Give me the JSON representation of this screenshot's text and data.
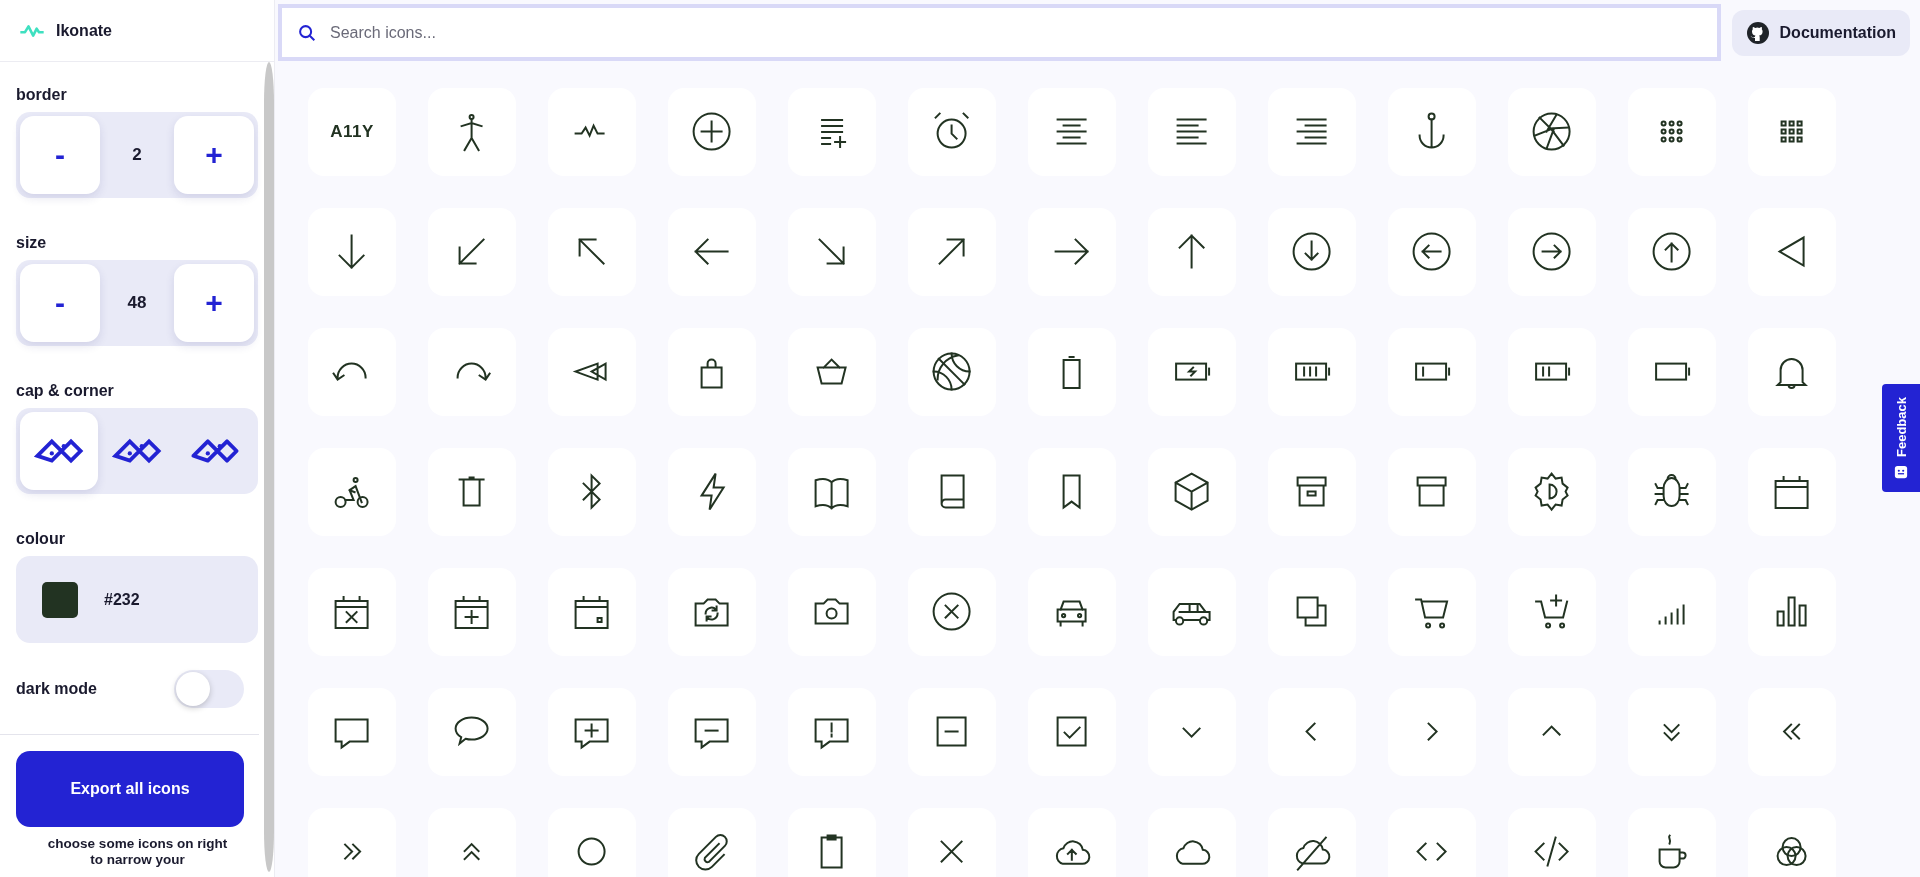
{
  "app": {
    "name": "Ikonate"
  },
  "search": {
    "placeholder": "Search icons..."
  },
  "documentation_button": {
    "label": "Documentation"
  },
  "sidebar": {
    "border": {
      "label": "border",
      "minus": "-",
      "value": "2",
      "plus": "+"
    },
    "size": {
      "label": "size",
      "minus": "-",
      "value": "48",
      "plus": "+"
    },
    "cap_corner": {
      "label": "cap & corner",
      "options": [
        {
          "kind": "square",
          "selected": true
        },
        {
          "kind": "round",
          "selected": false
        },
        {
          "kind": "rounded",
          "selected": false
        }
      ]
    },
    "colour": {
      "label": "colour",
      "value": "#232"
    },
    "dark_mode": {
      "label": "dark mode",
      "on": false
    },
    "export_button": {
      "label": "Export all icons"
    },
    "hint": "choose some icons on right to narrow your"
  },
  "icons": [
    {
      "kind": "text",
      "label": "A11Y"
    },
    {
      "kind": "person"
    },
    {
      "kind": "activity"
    },
    {
      "kind": "add-circle"
    },
    {
      "kind": "add-to-list"
    },
    {
      "kind": "alarm"
    },
    {
      "kind": "align-center"
    },
    {
      "kind": "align-left"
    },
    {
      "kind": "align-right"
    },
    {
      "kind": "anchor"
    },
    {
      "kind": "aperture"
    },
    {
      "kind": "dots-grid"
    },
    {
      "kind": "squares-grid"
    },
    {
      "kind": "arrow-down"
    },
    {
      "kind": "arrow-down-left"
    },
    {
      "kind": "arrow-up-left"
    },
    {
      "kind": "arrow-left"
    },
    {
      "kind": "arrow-down-right"
    },
    {
      "kind": "arrow-up-right"
    },
    {
      "kind": "arrow-right"
    },
    {
      "kind": "arrow-up"
    },
    {
      "kind": "circle-arrow-down"
    },
    {
      "kind": "circle-arrow-left"
    },
    {
      "kind": "circle-arrow-right"
    },
    {
      "kind": "circle-arrow-up"
    },
    {
      "kind": "triangle-left"
    },
    {
      "kind": "undo"
    },
    {
      "kind": "redo"
    },
    {
      "kind": "rewind"
    },
    {
      "kind": "bag"
    },
    {
      "kind": "basket"
    },
    {
      "kind": "ball"
    },
    {
      "kind": "battery-vertical"
    },
    {
      "kind": "battery-charging"
    },
    {
      "kind": "battery-full"
    },
    {
      "kind": "battery-low"
    },
    {
      "kind": "battery-medium"
    },
    {
      "kind": "battery-empty"
    },
    {
      "kind": "bell"
    },
    {
      "kind": "bike"
    },
    {
      "kind": "trash"
    },
    {
      "kind": "bluetooth"
    },
    {
      "kind": "bolt"
    },
    {
      "kind": "book-open"
    },
    {
      "kind": "book"
    },
    {
      "kind": "bookmark"
    },
    {
      "kind": "cube"
    },
    {
      "kind": "archive-box"
    },
    {
      "kind": "box"
    },
    {
      "kind": "brightness"
    },
    {
      "kind": "bug"
    },
    {
      "kind": "calendar"
    },
    {
      "kind": "calendar-remove"
    },
    {
      "kind": "calendar-add"
    },
    {
      "kind": "calendar-event"
    },
    {
      "kind": "camera-rotate"
    },
    {
      "kind": "camera"
    },
    {
      "kind": "close-circle"
    },
    {
      "kind": "car-front"
    },
    {
      "kind": "car-side"
    },
    {
      "kind": "copy"
    },
    {
      "kind": "cart"
    },
    {
      "kind": "cart-add"
    },
    {
      "kind": "signal"
    },
    {
      "kind": "bar-chart"
    },
    {
      "kind": "chat"
    },
    {
      "kind": "chat-bubble"
    },
    {
      "kind": "chat-add"
    },
    {
      "kind": "chat-remove"
    },
    {
      "kind": "chat-alert"
    },
    {
      "kind": "minus-square"
    },
    {
      "kind": "check-square"
    },
    {
      "kind": "chevron-down"
    },
    {
      "kind": "chevron-left"
    },
    {
      "kind": "chevron-right"
    },
    {
      "kind": "chevron-up"
    },
    {
      "kind": "chevrons-down"
    },
    {
      "kind": "chevrons-left"
    },
    {
      "kind": "chevrons-right"
    },
    {
      "kind": "chevrons-up"
    },
    {
      "kind": "circle"
    },
    {
      "kind": "paperclip"
    },
    {
      "kind": "clipboard"
    },
    {
      "kind": "close"
    },
    {
      "kind": "cloud-upload"
    },
    {
      "kind": "cloud"
    },
    {
      "kind": "cloud-off"
    },
    {
      "kind": "code"
    },
    {
      "kind": "code-slash"
    },
    {
      "kind": "cup"
    },
    {
      "kind": "three-circles"
    }
  ],
  "feedback_tab": {
    "label": "Feedback"
  }
}
